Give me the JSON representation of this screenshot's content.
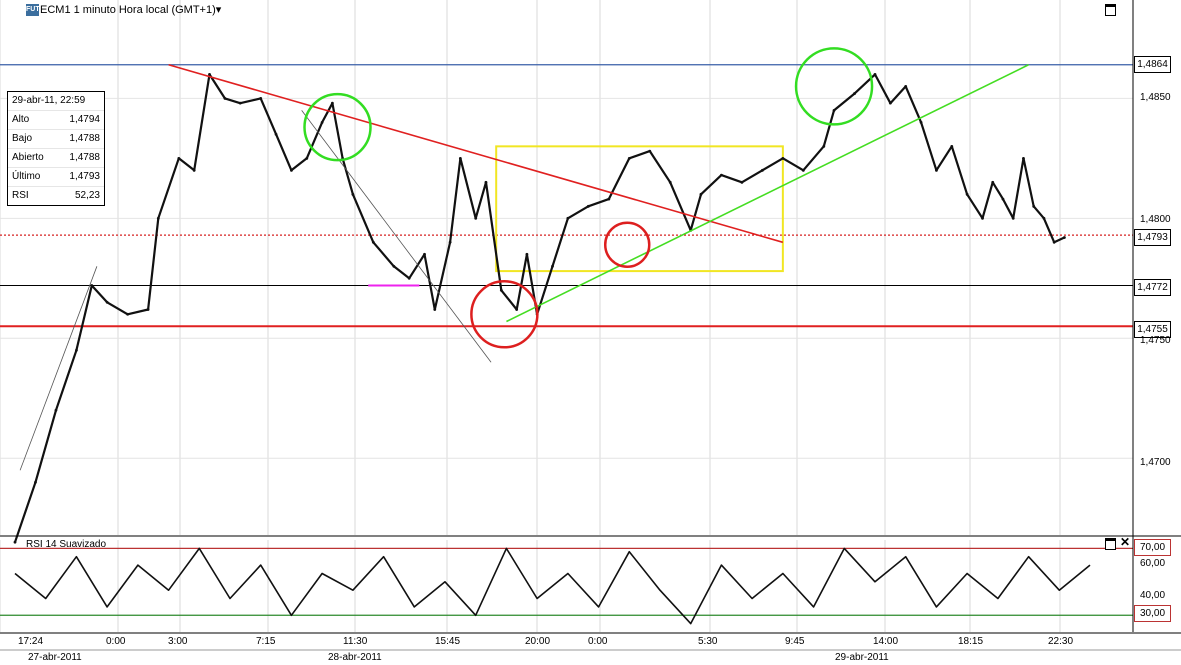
{
  "header": {
    "badge": "FUT",
    "title": "ECM1 1 minuto Hora local (GMT+1)"
  },
  "infobox": {
    "datetime": "29-abr-11, 22:59",
    "rows": [
      {
        "label": "Alto",
        "value": "1,4794"
      },
      {
        "label": "Bajo",
        "value": "1,4788"
      },
      {
        "label": "Abierto",
        "value": "1,4788"
      },
      {
        "label": "Último",
        "value": "1,4793"
      },
      {
        "label": "RSI",
        "value": "52,23"
      }
    ]
  },
  "price_tags": [
    {
      "label": "1,4864",
      "value": 1.4864,
      "color": "#cc2a2a"
    },
    {
      "label": "1,4793",
      "value": 1.4793,
      "color": "#cc2a2a"
    },
    {
      "label": "1,4772",
      "value": 1.4772,
      "color": "#cc2a2a"
    },
    {
      "label": "1,4755",
      "value": 1.4755,
      "color": "#cc2a2a"
    }
  ],
  "rsi_panel": {
    "label": "RSI 14 Suavizado",
    "tags": [
      {
        "label": "70,00",
        "value": 70
      },
      {
        "label": "30,00",
        "value": 30
      }
    ],
    "ticks": [
      "60,00",
      "40,00"
    ]
  },
  "chart_data": {
    "type": "line",
    "instrument": "ECM1",
    "y_ticks": [
      "1,4850",
      "1,4800",
      "1,4750",
      "1,4700"
    ],
    "y_tick_values": [
      1.485,
      1.48,
      1.475,
      1.47
    ],
    "ylim": [
      1.4668,
      1.4891
    ],
    "x_ticks": [
      "17:24",
      "0:00",
      "3:00",
      "7:15",
      "11:30",
      "15:45",
      "20:00",
      "0:00",
      "5:30",
      "9:45",
      "14:00",
      "18:15",
      "22:30"
    ],
    "date_labels": [
      "27-abr-2011",
      "28-abr-2011",
      "29-abr-2011"
    ],
    "price_series": [
      [
        0,
        1.4665
      ],
      [
        0.02,
        1.469
      ],
      [
        0.04,
        1.472
      ],
      [
        0.06,
        1.4745
      ],
      [
        0.075,
        1.4772
      ],
      [
        0.09,
        1.4765
      ],
      [
        0.11,
        1.476
      ],
      [
        0.13,
        1.4762
      ],
      [
        0.14,
        1.48
      ],
      [
        0.16,
        1.4825
      ],
      [
        0.175,
        1.482
      ],
      [
        0.19,
        1.486
      ],
      [
        0.205,
        1.485
      ],
      [
        0.22,
        1.4848
      ],
      [
        0.24,
        1.485
      ],
      [
        0.255,
        1.4835
      ],
      [
        0.27,
        1.482
      ],
      [
        0.285,
        1.4825
      ],
      [
        0.3,
        1.484
      ],
      [
        0.31,
        1.4848
      ],
      [
        0.32,
        1.4825
      ],
      [
        0.33,
        1.481
      ],
      [
        0.35,
        1.479
      ],
      [
        0.37,
        1.478
      ],
      [
        0.385,
        1.4775
      ],
      [
        0.4,
        1.4785
      ],
      [
        0.41,
        1.4762
      ],
      [
        0.425,
        1.479
      ],
      [
        0.435,
        1.4825
      ],
      [
        0.45,
        1.48
      ],
      [
        0.46,
        1.4815
      ],
      [
        0.475,
        1.477
      ],
      [
        0.49,
        1.4762
      ],
      [
        0.5,
        1.4785
      ],
      [
        0.51,
        1.476
      ],
      [
        0.525,
        1.478
      ],
      [
        0.54,
        1.48
      ],
      [
        0.56,
        1.4805
      ],
      [
        0.58,
        1.4808
      ],
      [
        0.6,
        1.4825
      ],
      [
        0.62,
        1.4828
      ],
      [
        0.64,
        1.4815
      ],
      [
        0.66,
        1.4795
      ],
      [
        0.67,
        1.481
      ],
      [
        0.69,
        1.4818
      ],
      [
        0.71,
        1.4815
      ],
      [
        0.73,
        1.482
      ],
      [
        0.75,
        1.4825
      ],
      [
        0.77,
        1.482
      ],
      [
        0.79,
        1.483
      ],
      [
        0.8,
        1.4845
      ],
      [
        0.82,
        1.4852
      ],
      [
        0.84,
        1.486
      ],
      [
        0.855,
        1.4848
      ],
      [
        0.87,
        1.4855
      ],
      [
        0.885,
        1.484
      ],
      [
        0.9,
        1.482
      ],
      [
        0.915,
        1.483
      ],
      [
        0.93,
        1.481
      ],
      [
        0.945,
        1.48
      ],
      [
        0.955,
        1.4815
      ],
      [
        0.965,
        1.4808
      ],
      [
        0.975,
        1.48
      ],
      [
        0.985,
        1.4825
      ],
      [
        0.995,
        1.4805
      ],
      [
        1.005,
        1.48
      ],
      [
        1.015,
        1.479
      ],
      [
        1.025,
        1.4792
      ]
    ],
    "annotations": {
      "hlines": [
        1.4864,
        1.4793,
        1.4772,
        1.4755
      ],
      "lines": [
        {
          "color": "#e02020",
          "from": [
            0.15,
            1.4864
          ],
          "to": [
            0.75,
            1.479
          ]
        },
        {
          "color": "#44dd22",
          "from": [
            0.48,
            1.4757
          ],
          "to": [
            0.99,
            1.4864
          ]
        }
      ],
      "box": {
        "color": "#f1e623",
        "x": [
          0.47,
          0.75
        ],
        "y": [
          1.4778,
          1.483
        ]
      }
    },
    "rsi_series": [
      [
        0,
        55
      ],
      [
        0.03,
        40
      ],
      [
        0.06,
        65
      ],
      [
        0.09,
        35
      ],
      [
        0.12,
        60
      ],
      [
        0.15,
        45
      ],
      [
        0.18,
        70
      ],
      [
        0.21,
        40
      ],
      [
        0.24,
        60
      ],
      [
        0.27,
        30
      ],
      [
        0.3,
        55
      ],
      [
        0.33,
        45
      ],
      [
        0.36,
        65
      ],
      [
        0.39,
        35
      ],
      [
        0.42,
        50
      ],
      [
        0.45,
        30
      ],
      [
        0.48,
        70
      ],
      [
        0.51,
        40
      ],
      [
        0.54,
        55
      ],
      [
        0.57,
        35
      ],
      [
        0.6,
        68
      ],
      [
        0.63,
        45
      ],
      [
        0.66,
        25
      ],
      [
        0.69,
        60
      ],
      [
        0.72,
        40
      ],
      [
        0.75,
        55
      ],
      [
        0.78,
        35
      ],
      [
        0.81,
        70
      ],
      [
        0.84,
        50
      ],
      [
        0.87,
        65
      ],
      [
        0.9,
        35
      ],
      [
        0.93,
        55
      ],
      [
        0.96,
        40
      ],
      [
        0.99,
        65
      ],
      [
        1.02,
        45
      ],
      [
        1.05,
        60
      ]
    ],
    "rsi_ylim": [
      20,
      75
    ]
  }
}
